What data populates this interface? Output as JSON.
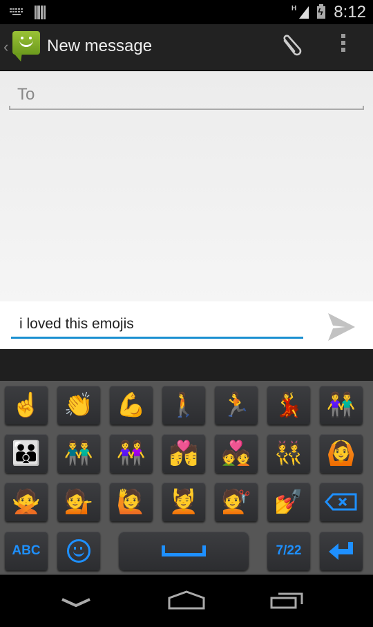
{
  "status_bar": {
    "time": "8:12",
    "network_type": "H",
    "icons": [
      "keyboard-icon",
      "barcode-icon",
      "signal-icon",
      "battery-charging-icon"
    ]
  },
  "action_bar": {
    "title": "New message",
    "app_icon": "messaging-icon",
    "actions": [
      "attach-icon",
      "overflow-menu-icon"
    ]
  },
  "compose": {
    "to_placeholder": "To",
    "to_value": ""
  },
  "message": {
    "text": "i loved this emojis",
    "send_icon": "send-icon"
  },
  "accent_color": "#1e90ff",
  "keyboard": {
    "emoji_rows": [
      [
        "☝️",
        "👏",
        "💪",
        "🚶",
        "🏃",
        "💃",
        "👫"
      ],
      [
        "👪",
        "👬",
        "👭",
        "💏",
        "💑",
        "👯",
        "🙆"
      ],
      [
        "🙅",
        "💁",
        "🙋",
        "💆",
        "💇",
        "💅"
      ]
    ],
    "delete_icon": "backspace-icon",
    "bottom_row": {
      "abc_label": "ABC",
      "emoji_icon": "smiley-icon",
      "space_icon": "space-icon",
      "page_label": "7/22",
      "enter_icon": "enter-icon"
    }
  },
  "nav_bar": {
    "buttons": [
      "back-down-icon",
      "home-icon",
      "recents-icon"
    ]
  }
}
